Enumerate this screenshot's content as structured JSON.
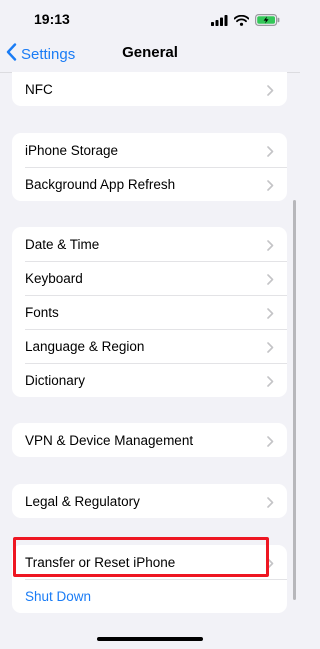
{
  "status_bar": {
    "time": "19:13"
  },
  "nav": {
    "back_label": "Settings",
    "title": "General"
  },
  "groups": [
    {
      "items": [
        {
          "label": "NFC"
        }
      ]
    },
    {
      "items": [
        {
          "label": "iPhone Storage"
        },
        {
          "label": "Background App Refresh"
        }
      ]
    },
    {
      "items": [
        {
          "label": "Date & Time"
        },
        {
          "label": "Keyboard"
        },
        {
          "label": "Fonts"
        },
        {
          "label": "Language & Region"
        },
        {
          "label": "Dictionary"
        }
      ]
    },
    {
      "items": [
        {
          "label": "VPN & Device Management"
        }
      ]
    },
    {
      "items": [
        {
          "label": "Legal & Regulatory"
        }
      ]
    },
    {
      "items": [
        {
          "label": "Transfer or Reset iPhone"
        },
        {
          "label": "Shut Down"
        }
      ]
    }
  ],
  "colors": {
    "accent": "#1a7cf5",
    "highlight": "#ee1622",
    "background": "#f2f2f7"
  },
  "icons": [
    "signal-icon",
    "wifi-icon",
    "battery-charging-icon",
    "chevron-left-icon",
    "chevron-right-icon"
  ]
}
